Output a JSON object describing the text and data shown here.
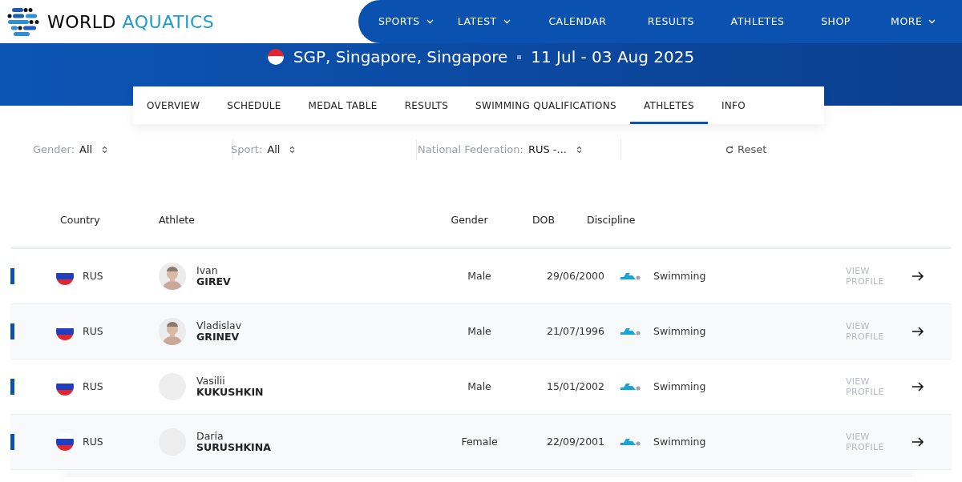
{
  "header": {
    "logo": {
      "word_1": "WORLD",
      "word_2": "AQUATICS"
    },
    "nav": [
      {
        "label": "SPORTS",
        "dropdown": true
      },
      {
        "label": "LATEST",
        "dropdown": true
      },
      {
        "label": "CALENDAR",
        "dropdown": false
      },
      {
        "label": "RESULTS",
        "dropdown": false
      },
      {
        "label": "ATHLETES",
        "dropdown": false
      },
      {
        "label": "SHOP",
        "dropdown": false
      },
      {
        "label": "MORE",
        "dropdown": true
      }
    ]
  },
  "event": {
    "location": "SGP, Singapore, Singapore",
    "dates": "11 Jul - 03 Aug 2025"
  },
  "tabs": [
    {
      "label": "OVERVIEW",
      "selected": false
    },
    {
      "label": "SCHEDULE",
      "selected": false
    },
    {
      "label": "MEDAL TABLE",
      "selected": false
    },
    {
      "label": "RESULTS",
      "selected": false
    },
    {
      "label": "SWIMMING QUALIFICATIONS",
      "selected": false
    },
    {
      "label": "ATHLETES",
      "selected": true
    },
    {
      "label": "INFO",
      "selected": false
    }
  ],
  "filters": [
    {
      "label": "Gender:",
      "value": "All"
    },
    {
      "label": "Sport:",
      "value": "All"
    },
    {
      "label": "National Federation:",
      "value": "RUS -..."
    }
  ],
  "reset": "Reset",
  "table": {
    "columns": [
      "Country",
      "Athlete",
      "Gender",
      "DOB",
      "Discipline"
    ],
    "rows": [
      {
        "country": "RUS",
        "first_name": "Ivan",
        "last_name": "GIREV",
        "gender": "Male",
        "dob": "29/06/2000",
        "discipline": "Swimming",
        "link": "VIEW PROFILE"
      },
      {
        "country": "RUS",
        "first_name": "Vladislav",
        "last_name": "GRINEV",
        "gender": "Male",
        "dob": "21/07/1996",
        "discipline": "Swimming",
        "link": "VIEW PROFILE"
      },
      {
        "country": "RUS",
        "first_name": "Vasilii",
        "last_name": "KUKUSHKIN",
        "avatar": {
          "kind": "placeholder"
        },
        "gender": "Male",
        "dob": "15/01/2002",
        "discipline": "Swimming",
        "link": "VIEW PROFILE"
      },
      {
        "country": "RUS",
        "first_name": "Daria",
        "last_name": "SURUSHKINA",
        "avatar": {
          "kind": "placeholder"
        },
        "gender": "Female",
        "dob": "22/09/2001",
        "discipline": "Swimming",
        "link": "VIEW PROFILE"
      }
    ]
  }
}
